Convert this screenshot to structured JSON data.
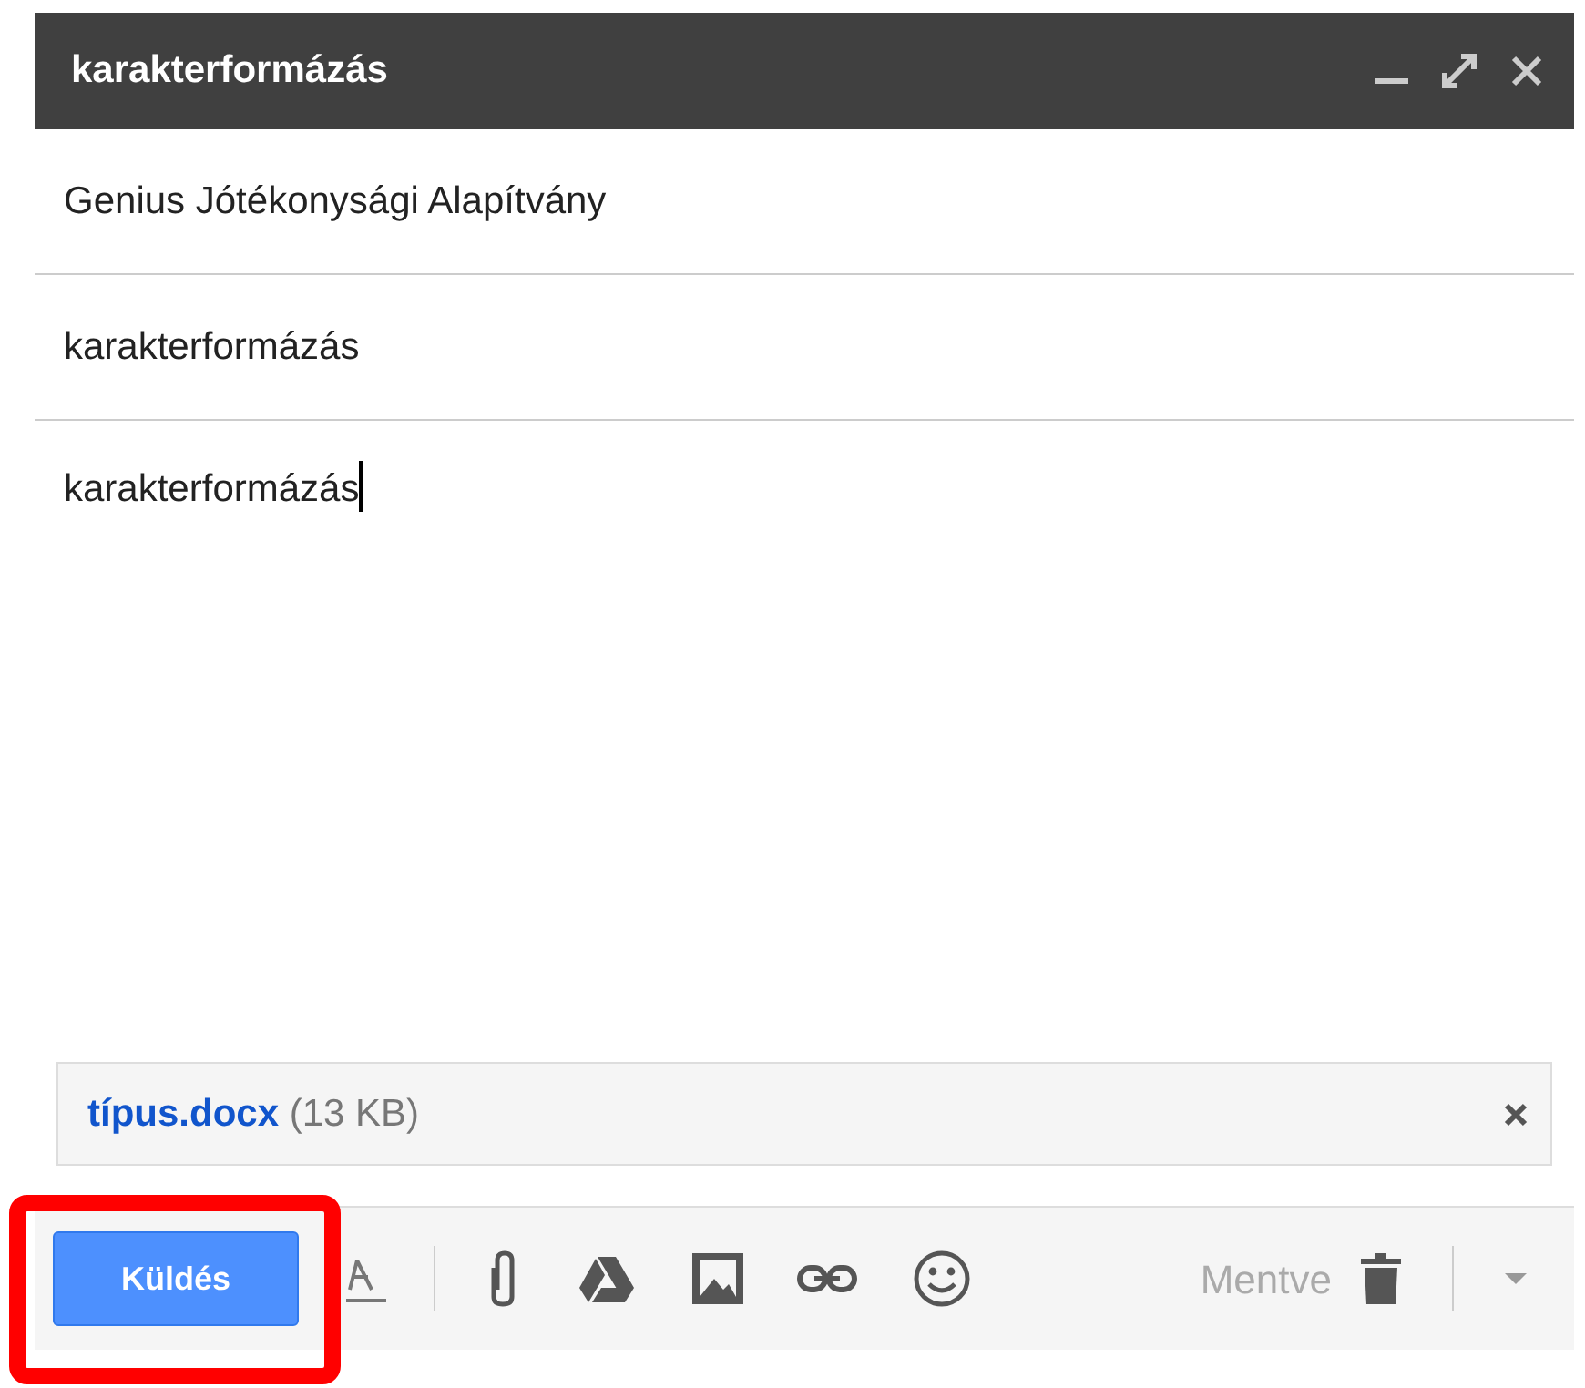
{
  "window": {
    "title": "karakterformázás"
  },
  "recipients": "Genius Jótékonysági Alapítvány",
  "subject": "karakterformázás",
  "body": "karakterformázás",
  "attachment": {
    "name": "típus.docx",
    "size": "(13 KB)"
  },
  "send_button": {
    "label": "Küldés",
    "highlighted": true
  },
  "save_status": "Mentve"
}
